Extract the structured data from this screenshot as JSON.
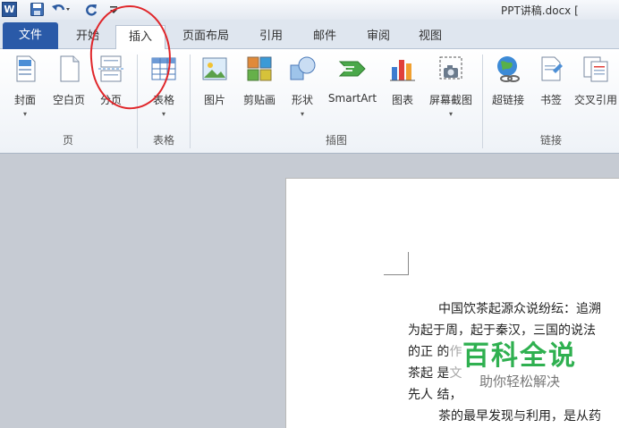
{
  "titlebar": {
    "word_logo": "W",
    "doc_title": "PPT讲稿.docx ["
  },
  "tabs": [
    {
      "label": "文件"
    },
    {
      "label": "开始"
    },
    {
      "label": "插入"
    },
    {
      "label": "页面布局"
    },
    {
      "label": "引用"
    },
    {
      "label": "邮件"
    },
    {
      "label": "审阅"
    },
    {
      "label": "视图"
    }
  ],
  "ribbon": {
    "buttons": [
      {
        "label": "封面",
        "icon": "cover-page-icon",
        "dropdown": true
      },
      {
        "label": "空白页",
        "icon": "blank-page-icon",
        "dropdown": false
      },
      {
        "label": "分页",
        "icon": "page-break-icon",
        "dropdown": false
      },
      {
        "label": "表格",
        "icon": "table-icon",
        "dropdown": true
      },
      {
        "label": "图片",
        "icon": "picture-icon",
        "dropdown": false
      },
      {
        "label": "剪贴画",
        "icon": "clip-art-icon",
        "dropdown": false
      },
      {
        "label": "形状",
        "icon": "shapes-icon",
        "dropdown": true
      },
      {
        "label": "SmartArt",
        "icon": "smartart-icon",
        "dropdown": false
      },
      {
        "label": "图表",
        "icon": "chart-icon",
        "dropdown": false
      },
      {
        "label": "屏幕截图",
        "icon": "screenshot-icon",
        "dropdown": true
      },
      {
        "label": "超链接",
        "icon": "hyperlink-icon",
        "dropdown": false
      },
      {
        "label": "书签",
        "icon": "bookmark-icon",
        "dropdown": false
      },
      {
        "label": "交叉引用",
        "icon": "cross-reference-icon",
        "dropdown": false
      }
    ],
    "groups": [
      {
        "label": "页"
      },
      {
        "label": "表格"
      },
      {
        "label": "插图"
      },
      {
        "label": "链接"
      }
    ],
    "dropdown_glyph": "▾"
  },
  "document": {
    "lines": [
      "中国饮茶起源众说纷纭：追溯",
      "为起于周，起于秦汉，三国的说法",
      "的正         的作",
      "茶起         是文",
      "先人         结，",
      "茶的最早发现与利用，是从药"
    ]
  },
  "watermark": {
    "main": "百科全说",
    "sub": "助你轻松解决"
  },
  "colors": {
    "file_tab": "#2a5aa8",
    "annotation": "#e0262a",
    "watermark_green": "#2fb050"
  }
}
